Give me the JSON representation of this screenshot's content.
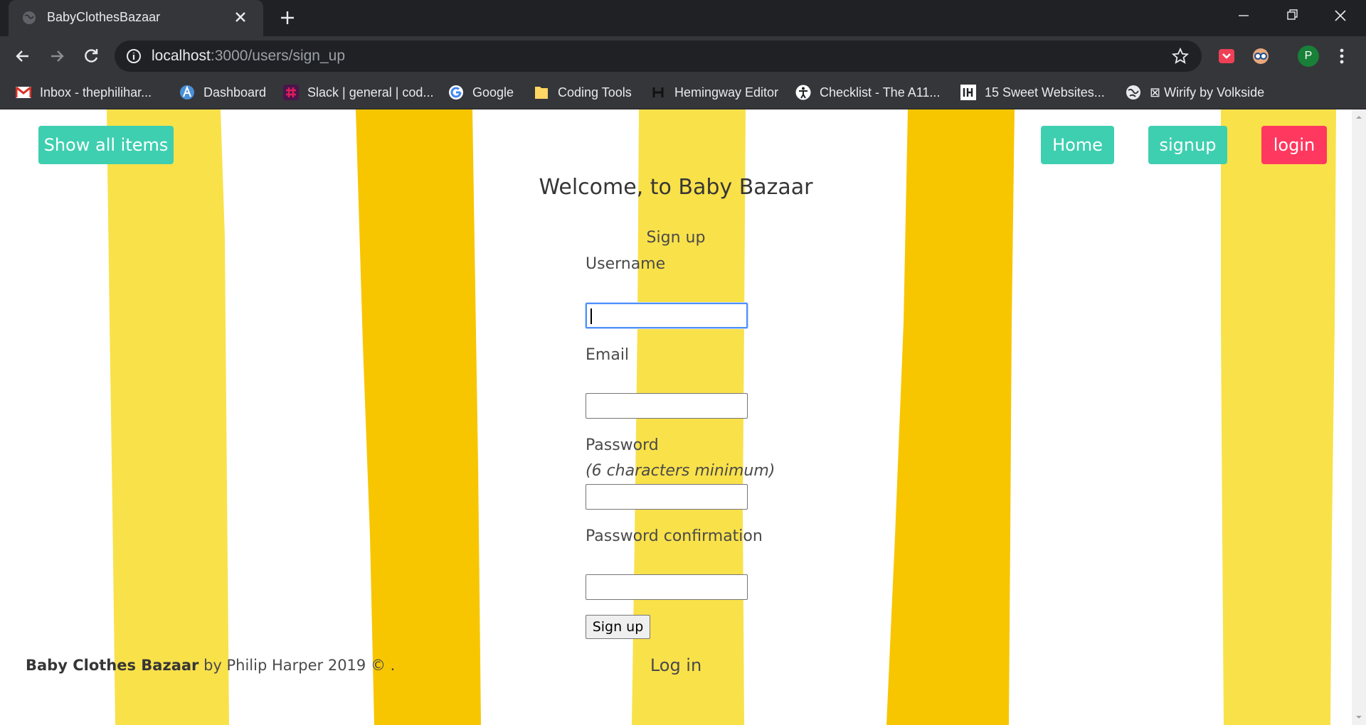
{
  "browser": {
    "tab_title": "BabyClothesBazaar",
    "url_host": "localhost",
    "url_path": ":3000/users/sign_up",
    "profile_initial": "P",
    "bookmarks": [
      {
        "label": "Inbox - thephilihar...",
        "icon": "gmail-icon"
      },
      {
        "label": "Dashboard",
        "icon": "dashboard-icon"
      },
      {
        "label": "Slack | general | cod...",
        "icon": "slack-icon"
      },
      {
        "label": "Google",
        "icon": "google-icon"
      },
      {
        "label": "Coding Tools",
        "icon": "folder-icon"
      },
      {
        "label": "Hemingway Editor",
        "icon": "hemingway-icon"
      },
      {
        "label": "Checklist - The A11...",
        "icon": "accessibility-icon"
      },
      {
        "label": "15 Sweet Websites...",
        "icon": "ih-icon"
      },
      {
        "label": "⊠ Wirify by Volkside",
        "icon": "globe-icon"
      }
    ]
  },
  "nav": {
    "show_all": "Show all items",
    "home": "Home",
    "signup": "signup",
    "login": "login"
  },
  "page": {
    "welcome": "Welcome, to Baby Bazaar",
    "heading": "Sign up",
    "username_label": "Username",
    "email_label": "Email",
    "password_label": "Password",
    "password_hint": "(6 characters minimum)",
    "password_confirmation_label": "Password confirmation",
    "username_value": "",
    "email_value": "",
    "password_value": "",
    "password_confirmation_value": "",
    "submit_label": "Sign up",
    "login_link": "Log in"
  },
  "footer": {
    "brand": "Baby Clothes Bazaar",
    "by": " by ",
    "author": "Philip Harper 2019 © ."
  },
  "colors": {
    "teal": "#3ecfb0",
    "red": "#ff3860",
    "stripe_light": "#f9e14a",
    "stripe_dark": "#f7c600"
  }
}
